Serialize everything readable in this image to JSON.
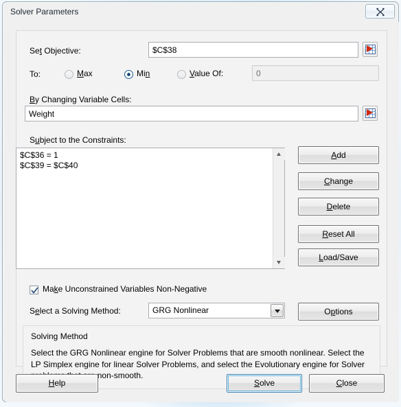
{
  "window": {
    "title": "Solver Parameters",
    "close_icon": "close-x-icon"
  },
  "objective": {
    "label_pre": "Se",
    "label_acc": "t",
    "label_post": " Objective:",
    "value": "$C$38",
    "range_picker_icon": "range-select-icon"
  },
  "to_row": {
    "label": "To:",
    "options": [
      {
        "id": "max",
        "pre": "",
        "acc": "M",
        "post": "ax",
        "selected": false
      },
      {
        "id": "min",
        "pre": "Mi",
        "acc": "n",
        "post": "",
        "selected": true
      },
      {
        "id": "value_of",
        "pre": "",
        "acc": "V",
        "post": "alue Of:",
        "selected": false
      }
    ],
    "value_of_field": {
      "value": "0",
      "enabled": false
    }
  },
  "variable_cells": {
    "label_pre": "",
    "label_acc": "B",
    "label_post": "y Changing Variable Cells:",
    "value": "Weight",
    "range_picker_icon": "range-select-icon"
  },
  "constraints": {
    "label_pre": "S",
    "label_acc": "u",
    "label_post": "bject to the Constraints:",
    "items": [
      "$C$36 = 1",
      "$C$39 = $C$40"
    ],
    "scroll_up_icon": "scroll-up-arrow-icon",
    "scroll_down_icon": "scroll-down-arrow-icon"
  },
  "side_buttons": [
    {
      "id": "add",
      "pre": "",
      "acc": "A",
      "post": "dd"
    },
    {
      "id": "change",
      "pre": "",
      "acc": "C",
      "post": "hange"
    },
    {
      "id": "delete",
      "pre": "",
      "acc": "D",
      "post": "elete"
    },
    {
      "id": "reset_all",
      "pre": "",
      "acc": "R",
      "post": "eset All"
    },
    {
      "id": "load_save",
      "pre": "",
      "acc": "L",
      "post": "oad/Save"
    }
  ],
  "non_negative": {
    "pre": "Ma",
    "acc": "k",
    "post": "e Unconstrained Variables Non-Negative",
    "checked": true,
    "check_icon": "checkmark-icon"
  },
  "solving_method": {
    "label_pre": "S",
    "label_acc": "e",
    "label_post": "lect a Solving Method:",
    "selected": "GRG Nonlinear",
    "dropdown_icon": "chevron-down-icon",
    "options_button": {
      "pre": "O",
      "acc": "p",
      "post": "tions"
    }
  },
  "method_group": {
    "title": "Solving Method",
    "description": "Select the GRG Nonlinear engine for Solver Problems that are smooth nonlinear. Select the LP Simplex engine for linear Solver Problems, and select the Evolutionary engine for Solver problems that are non-smooth."
  },
  "footer_buttons": [
    {
      "id": "help",
      "pre": "",
      "acc": "H",
      "post": "elp",
      "default": false
    },
    {
      "id": "solve",
      "pre": "",
      "acc": "S",
      "post": "olve",
      "default": true
    },
    {
      "id": "close",
      "pre": "",
      "acc": "C",
      "post": "lose",
      "default": false
    }
  ],
  "colors": {
    "accent_blue": "#3c7fb1",
    "window_bg": "#f0f0f0",
    "field_border": "#abadb3",
    "range_icon_red": "#d02b12"
  }
}
